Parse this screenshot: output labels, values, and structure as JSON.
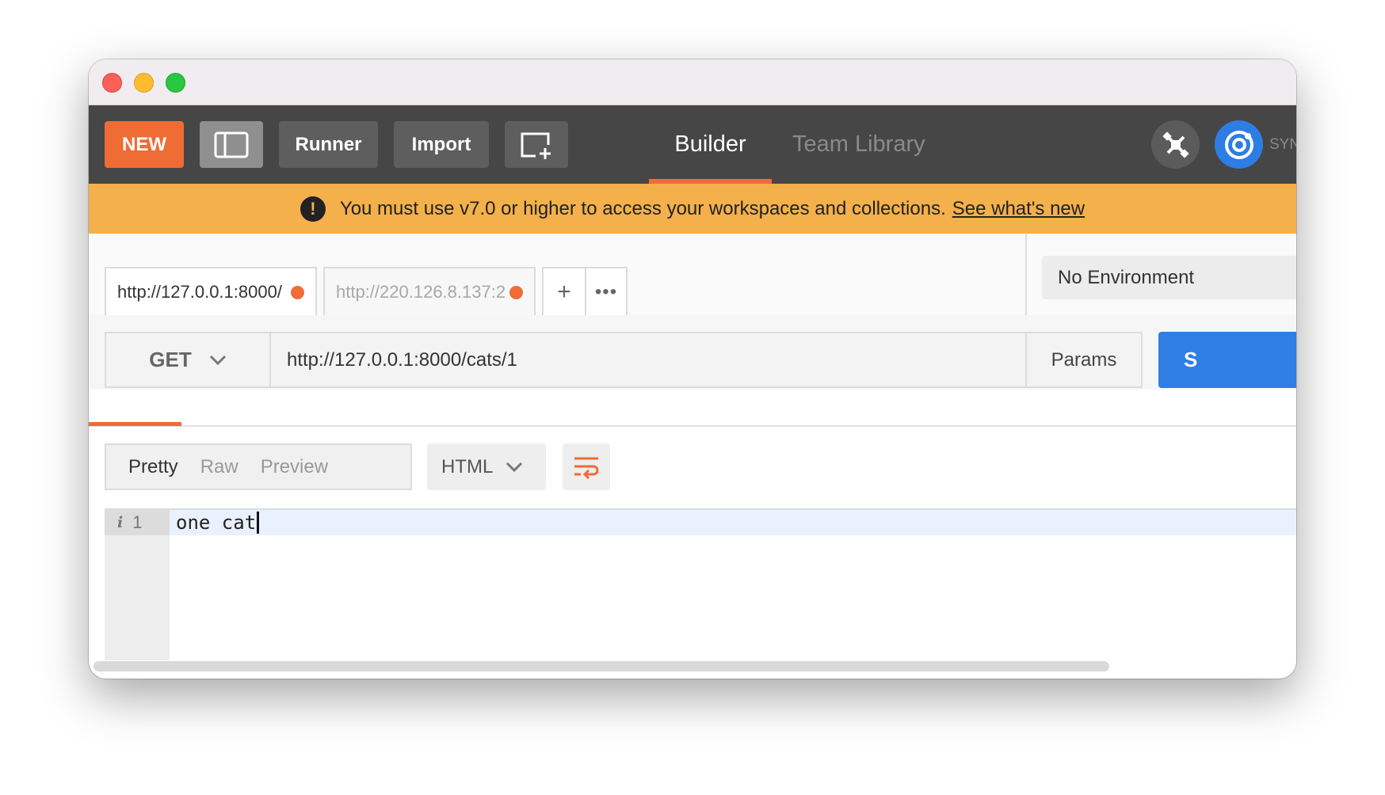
{
  "toolbar": {
    "new_label": "NEW",
    "runner_label": "Runner",
    "import_label": "Import",
    "nav": {
      "builder": "Builder",
      "team_library": "Team Library"
    },
    "sync_label": "SYN",
    "icons": {
      "sidebar": "sidebar-toggle-icon",
      "new_window": "new-window-icon",
      "interceptor": "satellite-icon",
      "sync": "sync-icon"
    }
  },
  "banner": {
    "message": "You must use v7.0 or higher to access your workspaces and collections.",
    "link": "See what's new",
    "icon": "warning-icon"
  },
  "request_tabs": [
    {
      "label": "http://127.0.0.1:8000/",
      "unsaved": true
    },
    {
      "label": "http://220.126.8.137:2",
      "unsaved": true
    }
  ],
  "tab_actions": {
    "add": "+",
    "more": "•••"
  },
  "environment": {
    "selected": "No Environment"
  },
  "request": {
    "method": "GET",
    "url": "http://127.0.0.1:8000/cats/1",
    "params_label": "Params",
    "send_label": "S"
  },
  "response": {
    "view_tabs": [
      "Pretty",
      "Raw",
      "Preview"
    ],
    "active_view": "Pretty",
    "format": "HTML",
    "lines": [
      {
        "number": "1",
        "info": "i",
        "text": "one cat"
      }
    ]
  },
  "colors": {
    "accent": "#ef6c35",
    "send": "#2f7ee4",
    "banner": "#f4b04a",
    "toolbar": "#464646"
  }
}
